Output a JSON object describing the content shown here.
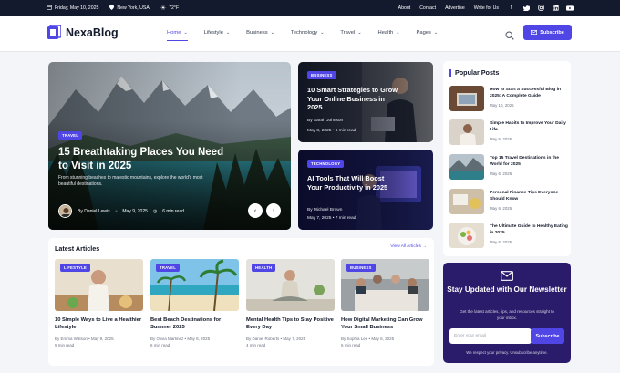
{
  "topbar": {
    "date": "Friday, May 10, 2025",
    "location": "New York, USA",
    "weather": "72°F",
    "links": [
      "About",
      "Contact",
      "Advertise",
      "Write for Us"
    ],
    "social": [
      "f",
      "t",
      "ig",
      "in",
      "yt"
    ]
  },
  "header": {
    "brand": "NexaBlog",
    "nav": [
      {
        "label": "Home"
      },
      {
        "label": "Lifestyle"
      },
      {
        "label": "Business"
      },
      {
        "label": "Technology"
      },
      {
        "label": "Travel"
      },
      {
        "label": "Health"
      },
      {
        "label": "Pages"
      }
    ],
    "subscribe": "Subscribe"
  },
  "hero": {
    "badge": "TRAVEL",
    "title": "15 Breathtaking Places You Need to Visit in 2025",
    "desc": "From stunning beaches to majestic mountains, explore the world's most beautiful destinations.",
    "author": "By Daniel Lewis",
    "date": "May 9, 2025",
    "read": "6 min read"
  },
  "side_cards": [
    {
      "badge": "BUSINESS",
      "title": "10 Smart Strategies to Grow Your Online Business in 2025",
      "author": "By Sarah Johnson",
      "date": "May 8, 2025",
      "read": "6 min read"
    },
    {
      "badge": "TECHNOLOGY",
      "title": "AI Tools That Will Boost Your Productivity in 2025",
      "author": "By Michael Brown",
      "date": "May 7, 2025",
      "read": "7 min read"
    }
  ],
  "latest": {
    "heading": "Latest Articles",
    "view_all": "View All Articles",
    "items": [
      {
        "badge": "LIFESTYLE",
        "title": "10 Simple Ways to Live a Healthier Lifestyle",
        "author": "By Emma Watson",
        "date": "May 9, 2025",
        "read": "5 min read"
      },
      {
        "badge": "TRAVEL",
        "title": "Best Beach Destinations for Summer 2025",
        "author": "By Olivia Martinez",
        "date": "May 8, 2025",
        "read": "6 min read"
      },
      {
        "badge": "HEALTH",
        "title": "Mental Health Tips to Stay Positive Every Day",
        "author": "By Daniel Roberts",
        "date": "May 7, 2025",
        "read": "4 min read"
      },
      {
        "badge": "BUSINESS",
        "title": "How Digital Marketing Can Grow Your Small Business",
        "author": "By Sophia Lee",
        "date": "May 6, 2025",
        "read": "6 min read"
      }
    ]
  },
  "popular": {
    "heading": "Popular Posts",
    "items": [
      {
        "title": "How to Start a Successful Blog in 2025: A Complete Guide",
        "date": "May 10, 2025"
      },
      {
        "title": "Simple Habits to Improve Your Daily Life",
        "date": "May 6, 2025"
      },
      {
        "title": "Top 15 Travel Destinations in the World for 2025",
        "date": "May 6, 2025"
      },
      {
        "title": "Personal Finance Tips Everyone Should Know",
        "date": "May 6, 2025"
      },
      {
        "title": "The Ultimate Guide to Healthy Eating in 2025",
        "date": "May 6, 2025"
      }
    ]
  },
  "newsletter": {
    "title": "Stay Updated with Our Newsletter",
    "desc": "Get the latest articles, tips, and resources straight to your inbox.",
    "placeholder": "Enter your email",
    "button": "Subscribe",
    "note": "We respect your privacy. Unsubscribe anytime."
  },
  "colors": {
    "accent": "#4f46e5",
    "topbar": "#141a2e",
    "newsletter_bg": "#2b1b6b"
  }
}
